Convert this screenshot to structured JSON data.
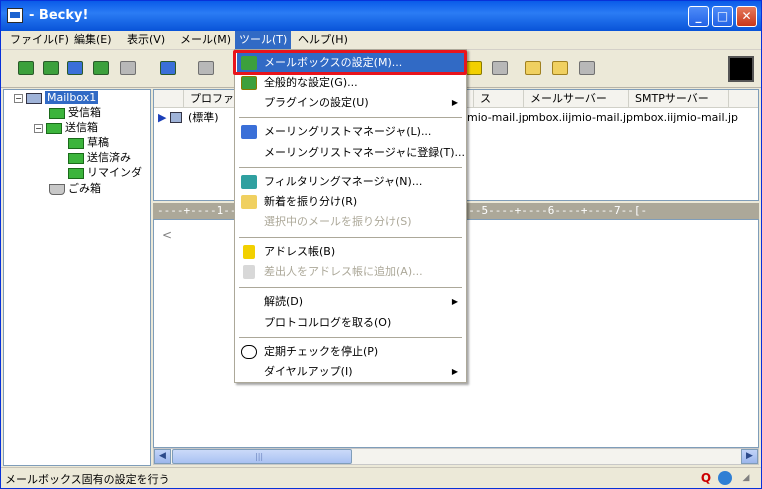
{
  "window": {
    "title": "- Becky!"
  },
  "titlebar_buttons": {
    "minimize": "_",
    "maximize": "□",
    "close": "✕"
  },
  "menubar": [
    "ファイル(F)",
    "編集(E)",
    "表示(V)",
    "メール(M)",
    "ツール(T)",
    "ヘルプ(H)"
  ],
  "tree": {
    "mailbox": "Mailbox1",
    "folders": [
      "受信箱",
      "送信箱",
      "草稿",
      "送信済み",
      "リマインダ",
      "ごみ箱"
    ]
  },
  "list": {
    "columns": [
      "プロファ",
      "ス",
      "メールサーバー",
      "SMTPサーバー"
    ],
    "row": {
      "profile": "(標準)",
      "address_tail": "mio-mail.jp",
      "mail_server": "mbox.iijmio-mail.jp",
      "smtp_server": "mbox.iijmio-mail.jp"
    }
  },
  "ruler": "----+----1----+----2----+----3----+----4----+----5----+----6----+----7--[-",
  "editor": {
    "caret": "<"
  },
  "tools_menu": {
    "items": [
      {
        "label": "メールボックスの設定(M)...",
        "icon": "mailbox-settings-icon",
        "highlighted": true
      },
      {
        "label": "全般的な設定(G)...",
        "icon": "general-settings-icon"
      },
      {
        "label": "プラグインの設定(U)",
        "submenu": true
      },
      {
        "label": "メーリングリストマネージャ(L)...",
        "icon": "mailing-list-icon"
      },
      {
        "label": "メーリングリストマネージャに登録(T)..."
      },
      {
        "label": "フィルタリングマネージャ(N)...",
        "icon": "filter-icon"
      },
      {
        "label": "新着を振り分け(R)",
        "icon": "sort-new-icon"
      },
      {
        "label": "選択中のメールを振り分け(S)",
        "disabled": true
      },
      {
        "label": "アドレス帳(B)",
        "icon": "address-book-icon"
      },
      {
        "label": "差出人をアドレス帳に追加(A)...",
        "icon": "add-address-icon",
        "disabled": true
      },
      {
        "label": "解読(D)",
        "submenu": true
      },
      {
        "label": "プロトコルログを取る(O)"
      },
      {
        "label": "定期チェックを停止(P)",
        "icon": "clock-icon"
      },
      {
        "label": "ダイヤルアップ(I)",
        "submenu": true
      }
    ]
  },
  "statusbar": {
    "text": "メールボックス固有の設定を行う",
    "icon_q": "Q"
  },
  "scroll": {
    "left": "◀",
    "right": "▶",
    "grip": "|||"
  },
  "colors": {
    "accent": "#316ac5",
    "highlight_border": "#e8141c",
    "title_blue": "#0a5be8"
  }
}
